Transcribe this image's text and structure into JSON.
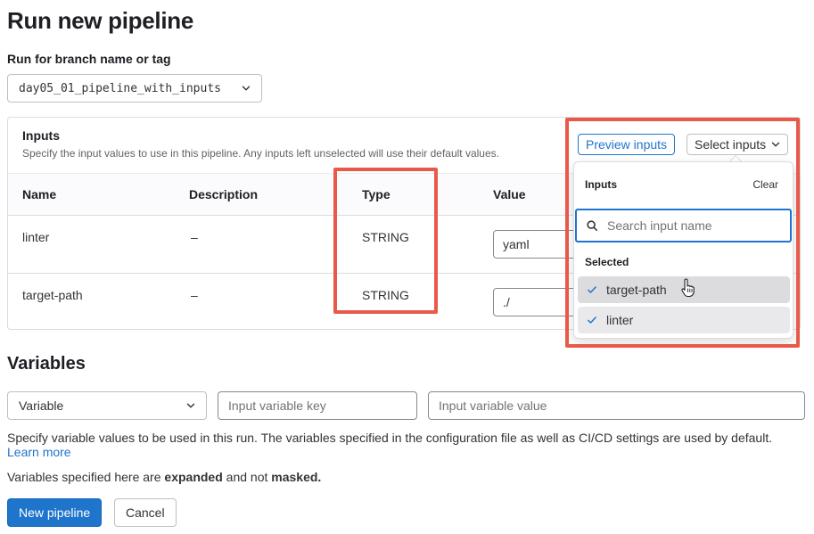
{
  "page": {
    "title": "Run new pipeline"
  },
  "branch": {
    "label": "Run for branch name or tag",
    "selected": "day05_01_pipeline_with_inputs"
  },
  "inputs": {
    "title": "Inputs",
    "description": "Specify the input values to use in this pipeline. Any inputs left unselected will use their default values.",
    "preview_label": "Preview inputs",
    "select_label": "Select inputs",
    "columns": [
      "Name",
      "Description",
      "Type",
      "Value"
    ],
    "rows": [
      {
        "name": "linter",
        "description": "–",
        "type": "STRING",
        "value": "yaml"
      },
      {
        "name": "target-path",
        "description": "–",
        "type": "STRING",
        "value": "./"
      }
    ]
  },
  "dropdown": {
    "header": "Inputs",
    "clear_label": "Clear",
    "search_placeholder": "Search input name",
    "section_label": "Selected",
    "items": [
      {
        "label": "target-path",
        "checked": true
      },
      {
        "label": "linter",
        "checked": true
      }
    ]
  },
  "variables": {
    "title": "Variables",
    "type_selected": "Variable",
    "key_placeholder": "Input variable key",
    "value_placeholder": "Input variable value",
    "help_text": "Specify variable values to be used in this run. The variables specified in the configuration file as well as CI/CD settings are used by default.",
    "learn_more": "Learn more",
    "note_prefix": "Variables specified here are",
    "note_expanded": "expanded",
    "note_middle": "and not",
    "note_masked": "masked."
  },
  "actions": {
    "primary": "New pipeline",
    "cancel": "Cancel"
  },
  "colors": {
    "accent": "#1f75cb",
    "highlight": "#e8594a",
    "text": "#333238"
  }
}
